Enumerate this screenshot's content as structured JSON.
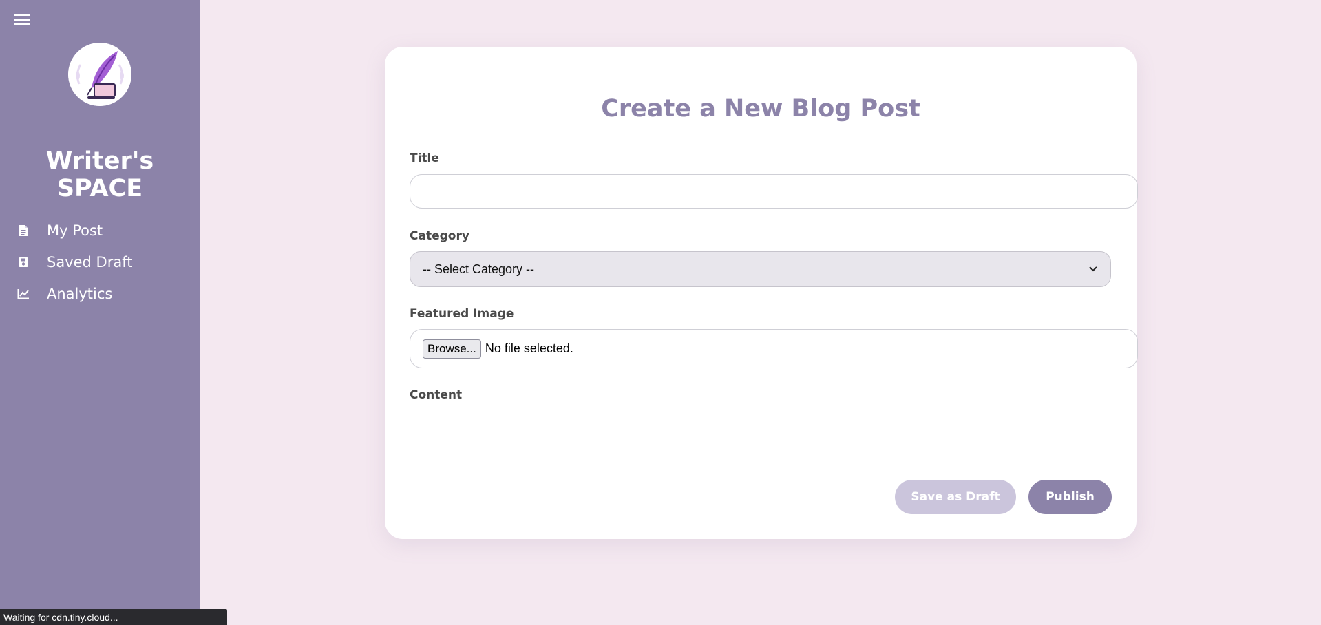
{
  "sidebar": {
    "brand": "Writer's SPACE",
    "items": [
      {
        "label": "My Post",
        "icon": "document-icon"
      },
      {
        "label": "Saved Draft",
        "icon": "save-icon"
      },
      {
        "label": "Analytics",
        "icon": "line-chart-icon"
      }
    ]
  },
  "form": {
    "title": "Create a New Blog Post",
    "title_label": "Title",
    "title_value": "",
    "category_label": "Category",
    "category_selected": "-- Select Category --",
    "image_label": "Featured Image",
    "browse_label": "Browse...",
    "file_status": "No file selected.",
    "content_label": "Content",
    "save_draft_label": "Save as Draft",
    "publish_label": "Publish"
  },
  "status_bar": {
    "text": "Waiting for cdn.tiny.cloud..."
  },
  "colors": {
    "accent": "#8c83a9",
    "background": "#f4e8f0",
    "draft_button": "#cbc5dc"
  }
}
